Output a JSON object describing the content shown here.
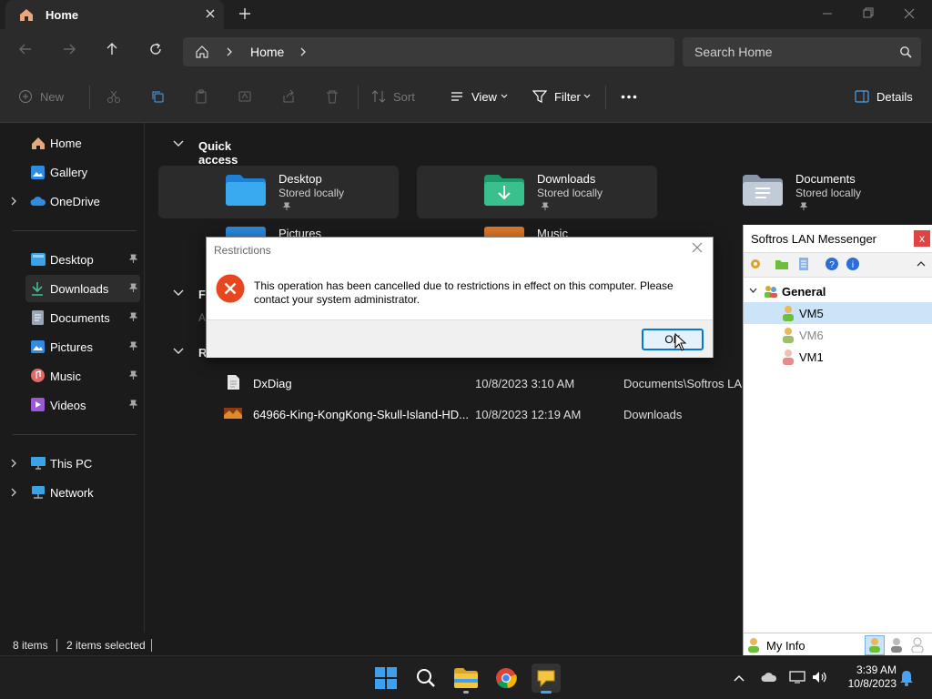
{
  "window": {
    "tab_title": "Home"
  },
  "address": {
    "crumb": "Home",
    "search_placeholder": "Search Home"
  },
  "toolbar": {
    "new": "New",
    "sort": "Sort",
    "view": "View",
    "filter": "Filter",
    "details": "Details"
  },
  "sidebar": {
    "items": [
      {
        "label": "Home",
        "icon": "home-icon"
      },
      {
        "label": "Gallery",
        "icon": "gallery-icon"
      },
      {
        "label": "OneDrive",
        "icon": "cloud-icon"
      },
      {
        "label": "Desktop",
        "icon": "desktop-icon"
      },
      {
        "label": "Downloads",
        "icon": "download-icon"
      },
      {
        "label": "Documents",
        "icon": "document-icon"
      },
      {
        "label": "Pictures",
        "icon": "pictures-icon"
      },
      {
        "label": "Music",
        "icon": "music-icon"
      },
      {
        "label": "Videos",
        "icon": "videos-icon"
      },
      {
        "label": "This PC",
        "icon": "pc-icon"
      },
      {
        "label": "Network",
        "icon": "network-icon"
      }
    ]
  },
  "content": {
    "quick_access_title": "Quick access",
    "favorites_partial": "F",
    "favorites_sub_partial": "A",
    "recent_partial": "R",
    "quick_access": [
      {
        "title": "Desktop",
        "sub": "Stored locally"
      },
      {
        "title": "Downloads",
        "sub": "Stored locally"
      },
      {
        "title": "Documents",
        "sub": "Stored locally"
      },
      {
        "title": "Pictures",
        "sub": ""
      },
      {
        "title": "Music",
        "sub": ""
      }
    ],
    "recent": [
      {
        "name": "DxDiag",
        "date": "10/8/2023 3:10 AM",
        "location": "Documents\\Softros LAN..."
      },
      {
        "name": "64966-King-KongKong-Skull-Island-HD...",
        "date": "10/8/2023 12:19 AM",
        "location": "Downloads"
      }
    ]
  },
  "status": {
    "items": "8 items",
    "selected": "2 items selected"
  },
  "dialog": {
    "title": "Restrictions",
    "message": "This operation has been cancelled due to restrictions in effect on this computer. Please contact your system administrator.",
    "ok": "OK"
  },
  "messenger": {
    "title": "Softros LAN Messenger",
    "close": "x",
    "group": "General",
    "users": [
      "VM5",
      "VM6",
      "VM1"
    ],
    "my_info": "My Info"
  },
  "taskbar": {
    "time": "3:39 AM",
    "date": "10/8/2023"
  }
}
